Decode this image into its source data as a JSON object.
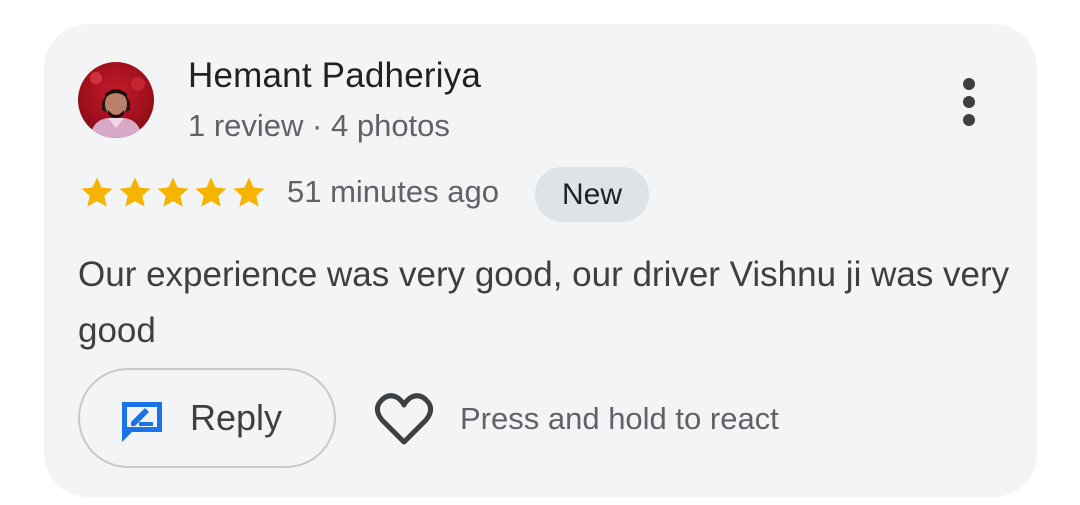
{
  "review": {
    "author": {
      "name": "Hemant Padheriya",
      "meta": "1 review · 4 photos",
      "avatar_icon": "user-photo-avatar"
    },
    "rating": {
      "stars": 5,
      "max": 5,
      "star_color": "#f4b400"
    },
    "time_ago": "51 minutes ago",
    "badge": "New",
    "text": "Our experience was very good, our driver Vishnu ji was very good",
    "more_icon": "more-vertical-icon"
  },
  "actions": {
    "reply_label": "Reply",
    "reply_icon": "reply-edit-icon",
    "reply_icon_color": "#1a73e8",
    "react_icon": "heart-outline-icon",
    "react_hint": "Press and hold to react"
  }
}
